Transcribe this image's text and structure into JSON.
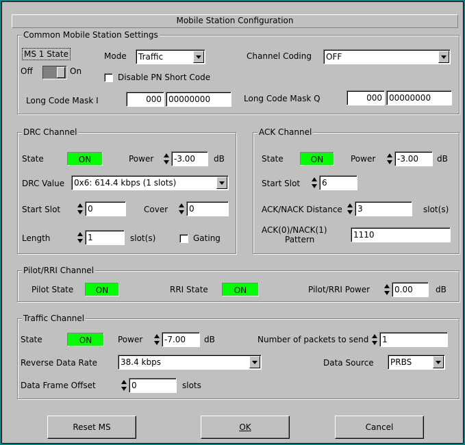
{
  "window": {
    "title": "Mobile Station Configuration"
  },
  "common": {
    "group_title": "Common Mobile Station Settings",
    "ms_state_label": "MS 1 State",
    "off_label": "Off",
    "on_label": "On",
    "mode_label": "Mode",
    "mode_value": "Traffic",
    "channel_coding_label": "Channel Coding",
    "channel_coding_value": "OFF",
    "disable_pn_label": "Disable PN Short Code",
    "long_code_mask_i_label": "Long Code Mask I",
    "long_code_mask_i_a": "000",
    "long_code_mask_i_b": "00000000",
    "long_code_mask_q_label": "Long Code Mask Q",
    "long_code_mask_q_a": "000",
    "long_code_mask_q_b": "00000000"
  },
  "drc": {
    "group_title": "DRC Channel",
    "state_label": "State",
    "state_value": "ON",
    "power_label": "Power",
    "power_value": "-3.00",
    "power_unit": "dB",
    "drc_value_label": "DRC Value",
    "drc_value": "0x6: 614.4 kbps (1 slots)",
    "start_slot_label": "Start Slot",
    "start_slot_value": "0",
    "cover_label": "Cover",
    "cover_value": "0",
    "length_label": "Length",
    "length_value": "1",
    "length_unit": "slot(s)",
    "gating_label": "Gating"
  },
  "ack": {
    "group_title": "ACK Channel",
    "state_label": "State",
    "state_value": "ON",
    "power_label": "Power",
    "power_value": "-3.00",
    "power_unit": "dB",
    "start_slot_label": "Start Slot",
    "start_slot_value": "6",
    "distance_label": "ACK/NACK Distance",
    "distance_value": "3",
    "distance_unit": "slot(s)",
    "pattern_label_1": "ACK(0)/NACK(1)",
    "pattern_label_2": "Pattern",
    "pattern_value": "1110"
  },
  "pilot": {
    "group_title": "Pilot/RRI Channel",
    "pilot_state_label": "Pilot State",
    "pilot_state_value": "ON",
    "rri_state_label": "RRI State",
    "rri_state_value": "ON",
    "power_label": "Pilot/RRI Power",
    "power_value": "0.00",
    "power_unit": "dB"
  },
  "traffic": {
    "group_title": "Traffic Channel",
    "state_label": "State",
    "state_value": "ON",
    "power_label": "Power",
    "power_value": "-7.00",
    "power_unit": "dB",
    "packets_label": "Number of packets to send",
    "packets_value": "1",
    "rate_label": "Reverse Data Rate",
    "rate_value": "38.4 kbps",
    "source_label": "Data Source",
    "source_value": "PRBS",
    "offset_label": "Data Frame Offset",
    "offset_value": "0",
    "offset_unit": "slots"
  },
  "buttons": {
    "reset": "Reset MS",
    "ok": "OK",
    "cancel": "Cancel"
  },
  "colors": {
    "on_indicator": "#00ff00",
    "dialog_bg": "#c0c0c0"
  }
}
